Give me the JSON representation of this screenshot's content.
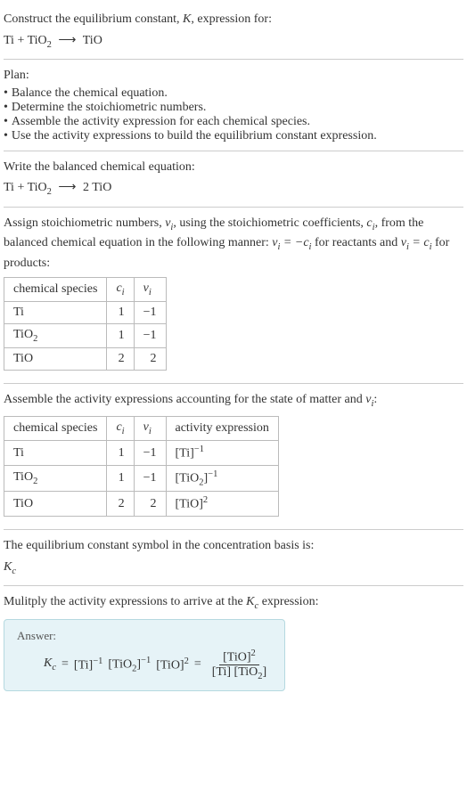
{
  "intro": {
    "prompt_line1": "Construct the equilibrium constant, ",
    "K": "K",
    "prompt_line1b": ", expression for:",
    "eq_lhs_ti": "Ti",
    "eq_plus": "+",
    "eq_tio2": "TiO",
    "eq_tio2_sub": "2",
    "eq_arrow": "⟶",
    "eq_rhs": "TiO"
  },
  "plan": {
    "heading": "Plan:",
    "items": [
      "Balance the chemical equation.",
      "Determine the stoichiometric numbers.",
      "Assemble the activity expression for each chemical species.",
      "Use the activity expressions to build the equilibrium constant expression."
    ]
  },
  "balanced": {
    "heading": "Write the balanced chemical equation:",
    "lhs_ti": "Ti",
    "plus": "+",
    "tio2": "TiO",
    "tio2_sub": "2",
    "arrow": "⟶",
    "rhs_coef": "2",
    "rhs": "TiO"
  },
  "stoich": {
    "text_a": "Assign stoichiometric numbers, ",
    "vi": "ν",
    "vi_sub": "i",
    "text_b": ", using the stoichiometric coefficients, ",
    "ci": "c",
    "ci_sub": "i",
    "text_c": ", from the balanced chemical equation in the following manner: ",
    "eq1_lhs_v": "ν",
    "eq1_lhs_sub": "i",
    "eq1_eq": " = −",
    "eq1_rhs_c": "c",
    "eq1_rhs_sub": "i",
    "text_d": " for reactants and ",
    "eq2_lhs_v": "ν",
    "eq2_lhs_sub": "i",
    "eq2_eq": " = ",
    "eq2_rhs_c": "c",
    "eq2_rhs_sub": "i",
    "text_e": " for products:",
    "table": {
      "headers": {
        "species": "chemical species",
        "ci": "c",
        "ci_sub": "i",
        "vi": "ν",
        "vi_sub": "i"
      },
      "rows": [
        {
          "species": "Ti",
          "sub": "",
          "ci": "1",
          "vi": "−1"
        },
        {
          "species": "TiO",
          "sub": "2",
          "ci": "1",
          "vi": "−1"
        },
        {
          "species": "TiO",
          "sub": "",
          "ci": "2",
          "vi": "2"
        }
      ]
    }
  },
  "activity": {
    "text_a": "Assemble the activity expressions accounting for the state of matter and ",
    "vi": "ν",
    "vi_sub": "i",
    "text_b": ":",
    "table": {
      "headers": {
        "species": "chemical species",
        "ci": "c",
        "ci_sub": "i",
        "vi": "ν",
        "vi_sub": "i",
        "act": "activity expression"
      },
      "rows": [
        {
          "species": "Ti",
          "sub": "",
          "ci": "1",
          "vi": "−1",
          "act_base": "[Ti]",
          "act_sup": "−1"
        },
        {
          "species": "TiO",
          "sub": "2",
          "ci": "1",
          "vi": "−1",
          "act_base_a": "[TiO",
          "act_base_sub": "2",
          "act_base_b": "]",
          "act_sup": "−1"
        },
        {
          "species": "TiO",
          "sub": "",
          "ci": "2",
          "vi": "2",
          "act_base": "[TiO]",
          "act_sup": "2"
        }
      ]
    }
  },
  "symbol": {
    "text": "The equilibrium constant symbol in the concentration basis is:",
    "Kc": "K",
    "Kc_sub": "c"
  },
  "multiply": {
    "text_a": "Mulitply the activity expressions to arrive at the ",
    "Kc": "K",
    "Kc_sub": "c",
    "text_b": " expression:"
  },
  "answer": {
    "label": "Answer:",
    "Kc": "K",
    "Kc_sub": "c",
    "eq": " = ",
    "term1_base": "[Ti]",
    "term1_sup": "−1",
    "term2_a": "[TiO",
    "term2_sub": "2",
    "term2_b": "]",
    "term2_sup": "−1",
    "term3_base": "[TiO]",
    "term3_sup": "2",
    "eq2": " = ",
    "frac_num_base": "[TiO]",
    "frac_num_sup": "2",
    "frac_den_ti": "[Ti]",
    "frac_den_tio2_a": "[TiO",
    "frac_den_tio2_sub": "2",
    "frac_den_tio2_b": "]"
  }
}
